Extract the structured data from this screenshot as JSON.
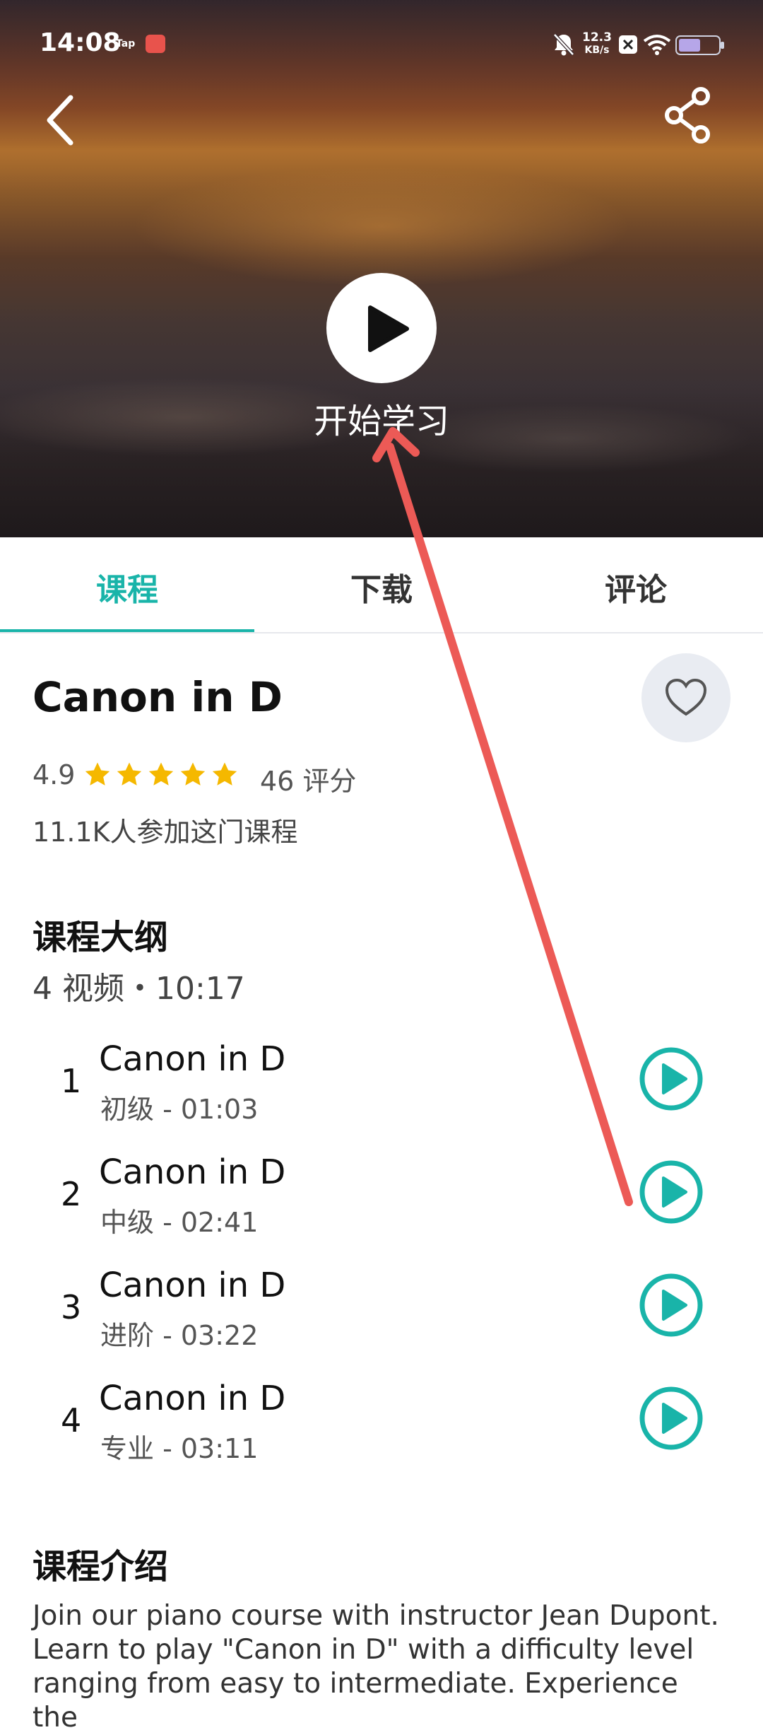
{
  "status_bar": {
    "time": "14:08",
    "tap": "Tap",
    "net_speed_value": "12.3",
    "net_speed_unit": "KB/s"
  },
  "hero": {
    "start_label": "开始学习"
  },
  "tabs": [
    {
      "label": "课程"
    },
    {
      "label": "下载"
    },
    {
      "label": "评论"
    }
  ],
  "course": {
    "title": "Canon in D",
    "rating": "4.9",
    "stars": 5,
    "rating_count": "46 评分",
    "joined": "11.1K人参加这门课程"
  },
  "syllabus": {
    "title": "课程大纲",
    "meta": "4 视频・10:17",
    "lessons": [
      {
        "index": "1",
        "name": "Canon in D",
        "sub": "初级 - 01:03"
      },
      {
        "index": "2",
        "name": "Canon in D",
        "sub": "中级 - 02:41"
      },
      {
        "index": "3",
        "name": "Canon in D",
        "sub": "进阶 - 03:22"
      },
      {
        "index": "4",
        "name": "Canon in D",
        "sub": "专业 - 03:11"
      }
    ]
  },
  "intro": {
    "title": "课程介绍",
    "text": "Join our piano course with instructor Jean Dupont. Learn to play \"Canon in D\" with a difficulty level ranging from easy to intermediate. Experience the"
  },
  "colors": {
    "accent": "#19b4a9",
    "star": "#f5b800",
    "annotation_arrow": "#ec5a56"
  }
}
